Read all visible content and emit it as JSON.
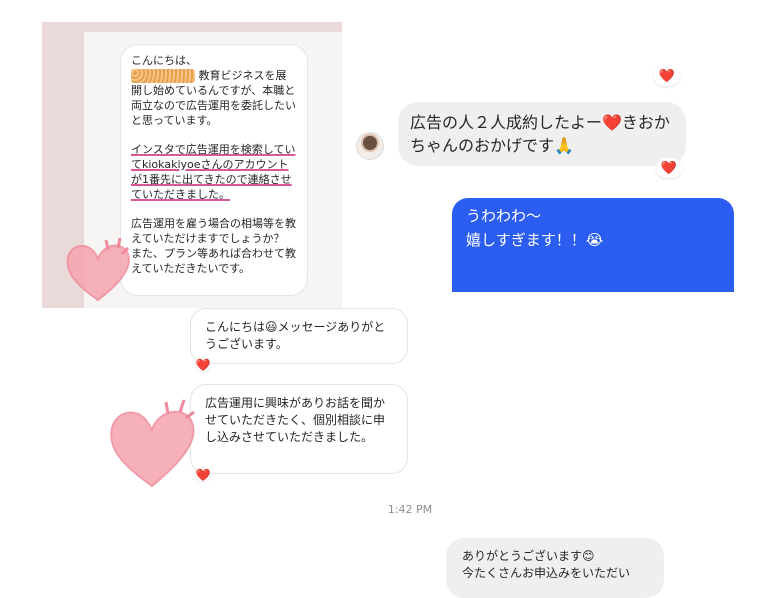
{
  "collage_card": {
    "para1_line1": "こんにちは、",
    "para1_rest": "教育ビジネスを展開し始めているんですが、本職と両立なので広告運用を委託したいと思っています。",
    "para2": "インスタで広告運用を検索していてkiokakiyoeさんのアカウントが1番先に出てきたので連絡させていただきました。",
    "para3": "広告運用を雇う場合の相場等を教えていただけますでしょうか？\nまた、プラン等あれば合わせて教えていただきたいです。"
  },
  "thread": {
    "top_reaction": "❤️",
    "incoming_message": "広告の人２人成約したよー❤️きおかちゃんのおかげです🙏",
    "incoming_reaction": "❤️",
    "outgoing_message_line1": "うわわわ〜",
    "outgoing_message_line2": "嬉しすぎます！！😭",
    "reply1": "こんにちは😃メッセージありがとうございます。",
    "reply1_reaction": "❤️",
    "reply2": "広告運用に興味がありお話を聞かせていただきたく、個別相談に申し込みさせていただきました。",
    "reply2_reaction": "❤️",
    "timestamp": "1:42 PM",
    "bottom_message": "ありがとうございます😊\n今たくさんお申込みをいただい"
  },
  "colors": {
    "accent_blue": "#2a5df0",
    "heart_pink": "#f08ca0",
    "reaction_red": "#e0245e"
  }
}
